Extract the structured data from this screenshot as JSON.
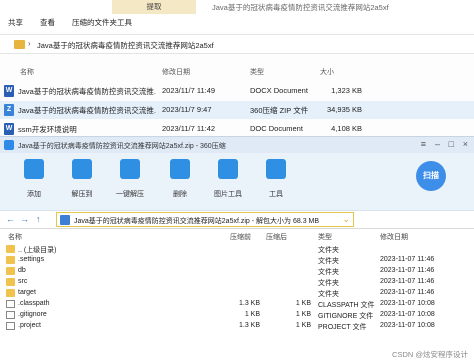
{
  "explorer": {
    "ribbon": {
      "extract_tab": "提取",
      "window_title_hint": "Java基于的冠状病毒疫情防控资讯交流推荐网站2a5xf",
      "tabs": [
        "共享",
        "查看",
        "压缩的文件夹工具"
      ]
    },
    "address": {
      "path": "Java基于的冠状病毒疫情防控资讯交流推荐网站2a5xf"
    },
    "columns": [
      "名称",
      "修改日期",
      "类型",
      "大小"
    ],
    "files": [
      {
        "icon": "word-doc-icon",
        "name": "Java基于的冠状病毒疫情防控资讯交流推...",
        "date": "2023/11/7 11:49",
        "type": "DOCX Document",
        "size": "1,323 KB",
        "selected": false
      },
      {
        "icon": "zip-archive-icon",
        "name": "Java基于的冠状病毒疫情防控资讯交流推...",
        "date": "2023/11/7 9:47",
        "type": "360压缩 ZIP 文件",
        "size": "34,935 KB",
        "selected": true
      },
      {
        "icon": "word-doc-icon",
        "name": "ssm开发环境说明",
        "date": "2023/11/7 11:42",
        "type": "DOC Document",
        "size": "4,108 KB",
        "selected": false
      }
    ]
  },
  "zip": {
    "title": "Java基于的冠状病毒疫情防控资讯交流推荐网站2a5xf.zip - 360压缩",
    "toolbar": [
      {
        "label": "添加",
        "icon": "add-icon",
        "color": "#2f8fe3"
      },
      {
        "label": "解压到",
        "icon": "extract-to-icon",
        "color": "#2f8fe3"
      },
      {
        "label": "一键解压",
        "icon": "one-click-extract-icon",
        "color": "#2f8fe3"
      },
      {
        "label": "删除",
        "icon": "delete-icon",
        "color": "#2f8fe3"
      },
      {
        "label": "图片工具",
        "icon": "image-tools-icon",
        "color": "#2f8fe3"
      },
      {
        "label": "工具",
        "icon": "tools-icon",
        "color": "#2f8fe3"
      }
    ],
    "scan_label": "扫描",
    "pathbar": {
      "text": "Java基于的冠状病毒疫情防控资讯交流推荐网站2a5xf.zip - 解包大小为 68.3 MB"
    },
    "columns": [
      "名称",
      "压缩前",
      "压缩后",
      "类型",
      "修改日期"
    ],
    "rows": [
      {
        "kind": "folder",
        "name": ".. (上级目录)",
        "before": "",
        "after": "",
        "type": "文件夹",
        "date": ""
      },
      {
        "kind": "folder",
        "name": ".settings",
        "before": "",
        "after": "",
        "type": "文件夹",
        "date": "2023-11-07 11:46"
      },
      {
        "kind": "folder",
        "name": "db",
        "before": "",
        "after": "",
        "type": "文件夹",
        "date": "2023-11-07 11:46"
      },
      {
        "kind": "folder",
        "name": "src",
        "before": "",
        "after": "",
        "type": "文件夹",
        "date": "2023-11-07 11:46"
      },
      {
        "kind": "folder",
        "name": "target",
        "before": "",
        "after": "",
        "type": "文件夹",
        "date": "2023-11-07 11:46"
      },
      {
        "kind": "file",
        "name": ".classpath",
        "before": "1.3 KB",
        "after": "1 KB",
        "type": "CLASSPATH 文件",
        "date": "2023-11-07 10:08"
      },
      {
        "kind": "file",
        "name": ".gitignore",
        "before": "1 KB",
        "after": "1 KB",
        "type": "GITIGNORE 文件",
        "date": "2023-11-07 10:08"
      },
      {
        "kind": "file",
        "name": ".project",
        "before": "1.3 KB",
        "after": "1 KB",
        "type": "PROJECT 文件",
        "date": "2023-11-07 10:08"
      }
    ]
  },
  "watermark": "CSDN @炫安程序设计"
}
